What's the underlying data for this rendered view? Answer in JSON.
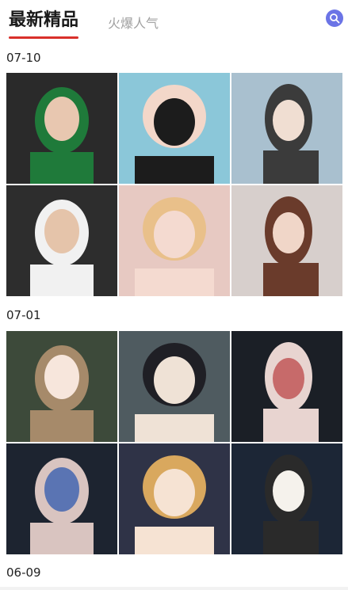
{
  "header": {
    "tab_active": "最新精品",
    "tab_inactive": "火爆人气",
    "accent_color": "#d9302b",
    "search_icon": "search-icon"
  },
  "sections": [
    {
      "date": "07-10",
      "images": [
        {
          "name": "photo-woman-green",
          "palette": [
            "#2a2a2a",
            "#1f7a3a",
            "#e8c7b0"
          ]
        },
        {
          "name": "photo-girl-hands-face",
          "palette": [
            "#8bc7d9",
            "#f3d7c9",
            "#1c1c1c"
          ]
        },
        {
          "name": "photo-girl-beret",
          "palette": [
            "#a9c0cf",
            "#3b3b3b",
            "#f0ded2"
          ]
        },
        {
          "name": "photo-man-dancing",
          "palette": [
            "#2d2d2d",
            "#f1f1f1",
            "#e5c4aa"
          ]
        },
        {
          "name": "photo-blonde-smile",
          "palette": [
            "#e7c9c2",
            "#e9c08a",
            "#f4dad0"
          ]
        },
        {
          "name": "photo-girl-curly-hair",
          "palette": [
            "#d7cfcc",
            "#6a3b2b",
            "#f0d6c8"
          ]
        }
      ]
    },
    {
      "date": "07-01",
      "images": [
        {
          "name": "anime-girl-brown-hair",
          "palette": [
            "#3d4a3a",
            "#a68a6a",
            "#f7e6dc"
          ]
        },
        {
          "name": "anime-boy-dark-hair",
          "palette": [
            "#4f5b60",
            "#1f1f25",
            "#efe2d6"
          ]
        },
        {
          "name": "art-face-closeup",
          "palette": [
            "#1b1f26",
            "#e8d4d0",
            "#c76a6a"
          ]
        },
        {
          "name": "art-eye-closeup",
          "palette": [
            "#1d2430",
            "#d9c4c0",
            "#5a74b3"
          ]
        },
        {
          "name": "anime-girls-hug",
          "palette": [
            "#2f3347",
            "#d9a85e",
            "#f6e3d3"
          ]
        },
        {
          "name": "anime-girl-patted",
          "palette": [
            "#1c2636",
            "#2a2a2a",
            "#f5f2ec"
          ]
        }
      ]
    },
    {
      "date": "06-09",
      "images": []
    }
  ]
}
